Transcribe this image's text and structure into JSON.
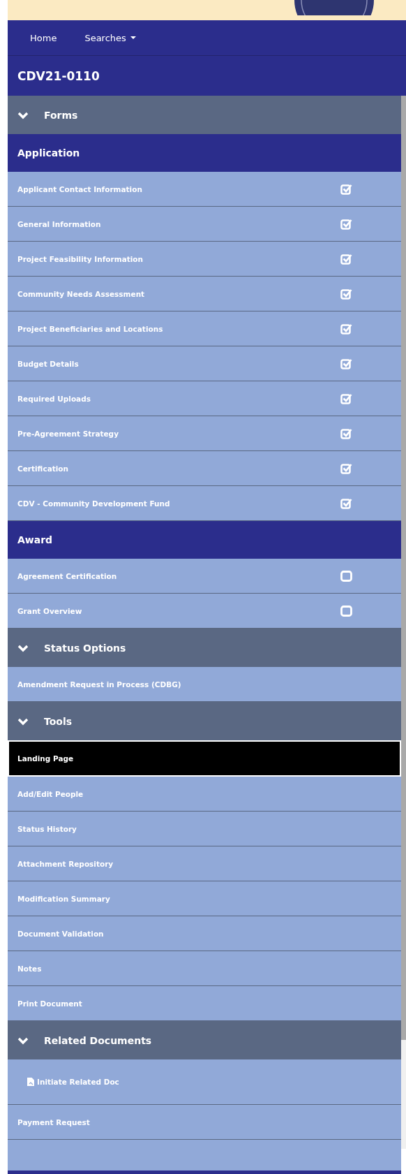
{
  "nav": [
    {
      "label": "Home",
      "dropdown": false
    },
    {
      "label": "Searches",
      "dropdown": true
    }
  ],
  "document_id": "CDV21-0110",
  "sections": [
    {
      "title": "Forms",
      "expanded": true,
      "rows": [
        {
          "kind": "category",
          "label": "Application"
        },
        {
          "kind": "form",
          "label": "Applicant Contact Information",
          "checked": true
        },
        {
          "kind": "form",
          "label": "General Information",
          "checked": true
        },
        {
          "kind": "form",
          "label": "Project Feasibility Information",
          "checked": true
        },
        {
          "kind": "form",
          "label": "Community Needs Assessment",
          "checked": true
        },
        {
          "kind": "form",
          "label": "Project Beneficiaries and Locations",
          "checked": true
        },
        {
          "kind": "form",
          "label": "Budget Details",
          "checked": true
        },
        {
          "kind": "form",
          "label": "Required Uploads",
          "checked": true
        },
        {
          "kind": "form",
          "label": "Pre-Agreement Strategy",
          "checked": true
        },
        {
          "kind": "form",
          "label": "Certification",
          "checked": true
        },
        {
          "kind": "form",
          "label": "CDV - Community Development Fund",
          "checked": true
        },
        {
          "kind": "category",
          "label": "Award"
        },
        {
          "kind": "form",
          "label": "Agreement Certification",
          "checked": false
        },
        {
          "kind": "form",
          "label": "Grant Overview",
          "checked": false
        }
      ]
    },
    {
      "title": "Status Options",
      "expanded": true,
      "rows": [
        {
          "kind": "link",
          "label": "Amendment Request in Process (CDBG)",
          "selected": false
        }
      ]
    },
    {
      "title": "Tools",
      "expanded": true,
      "rows": [
        {
          "kind": "link",
          "label": "Landing Page",
          "selected": true
        },
        {
          "kind": "link",
          "label": "Add/Edit People",
          "selected": false
        },
        {
          "kind": "link",
          "label": "Status History",
          "selected": false
        },
        {
          "kind": "link",
          "label": "Attachment Repository",
          "selected": false
        },
        {
          "kind": "link",
          "label": "Modification Summary",
          "selected": false
        },
        {
          "kind": "link",
          "label": "Document Validation",
          "selected": false
        },
        {
          "kind": "link",
          "label": "Notes",
          "selected": false
        },
        {
          "kind": "link",
          "label": "Print Document",
          "selected": false
        }
      ]
    },
    {
      "title": "Related Documents",
      "expanded": true,
      "rows": [
        {
          "kind": "action",
          "label": "Initiate Related Doc"
        },
        {
          "kind": "link",
          "label": "Payment Request",
          "selected": false
        }
      ]
    }
  ]
}
